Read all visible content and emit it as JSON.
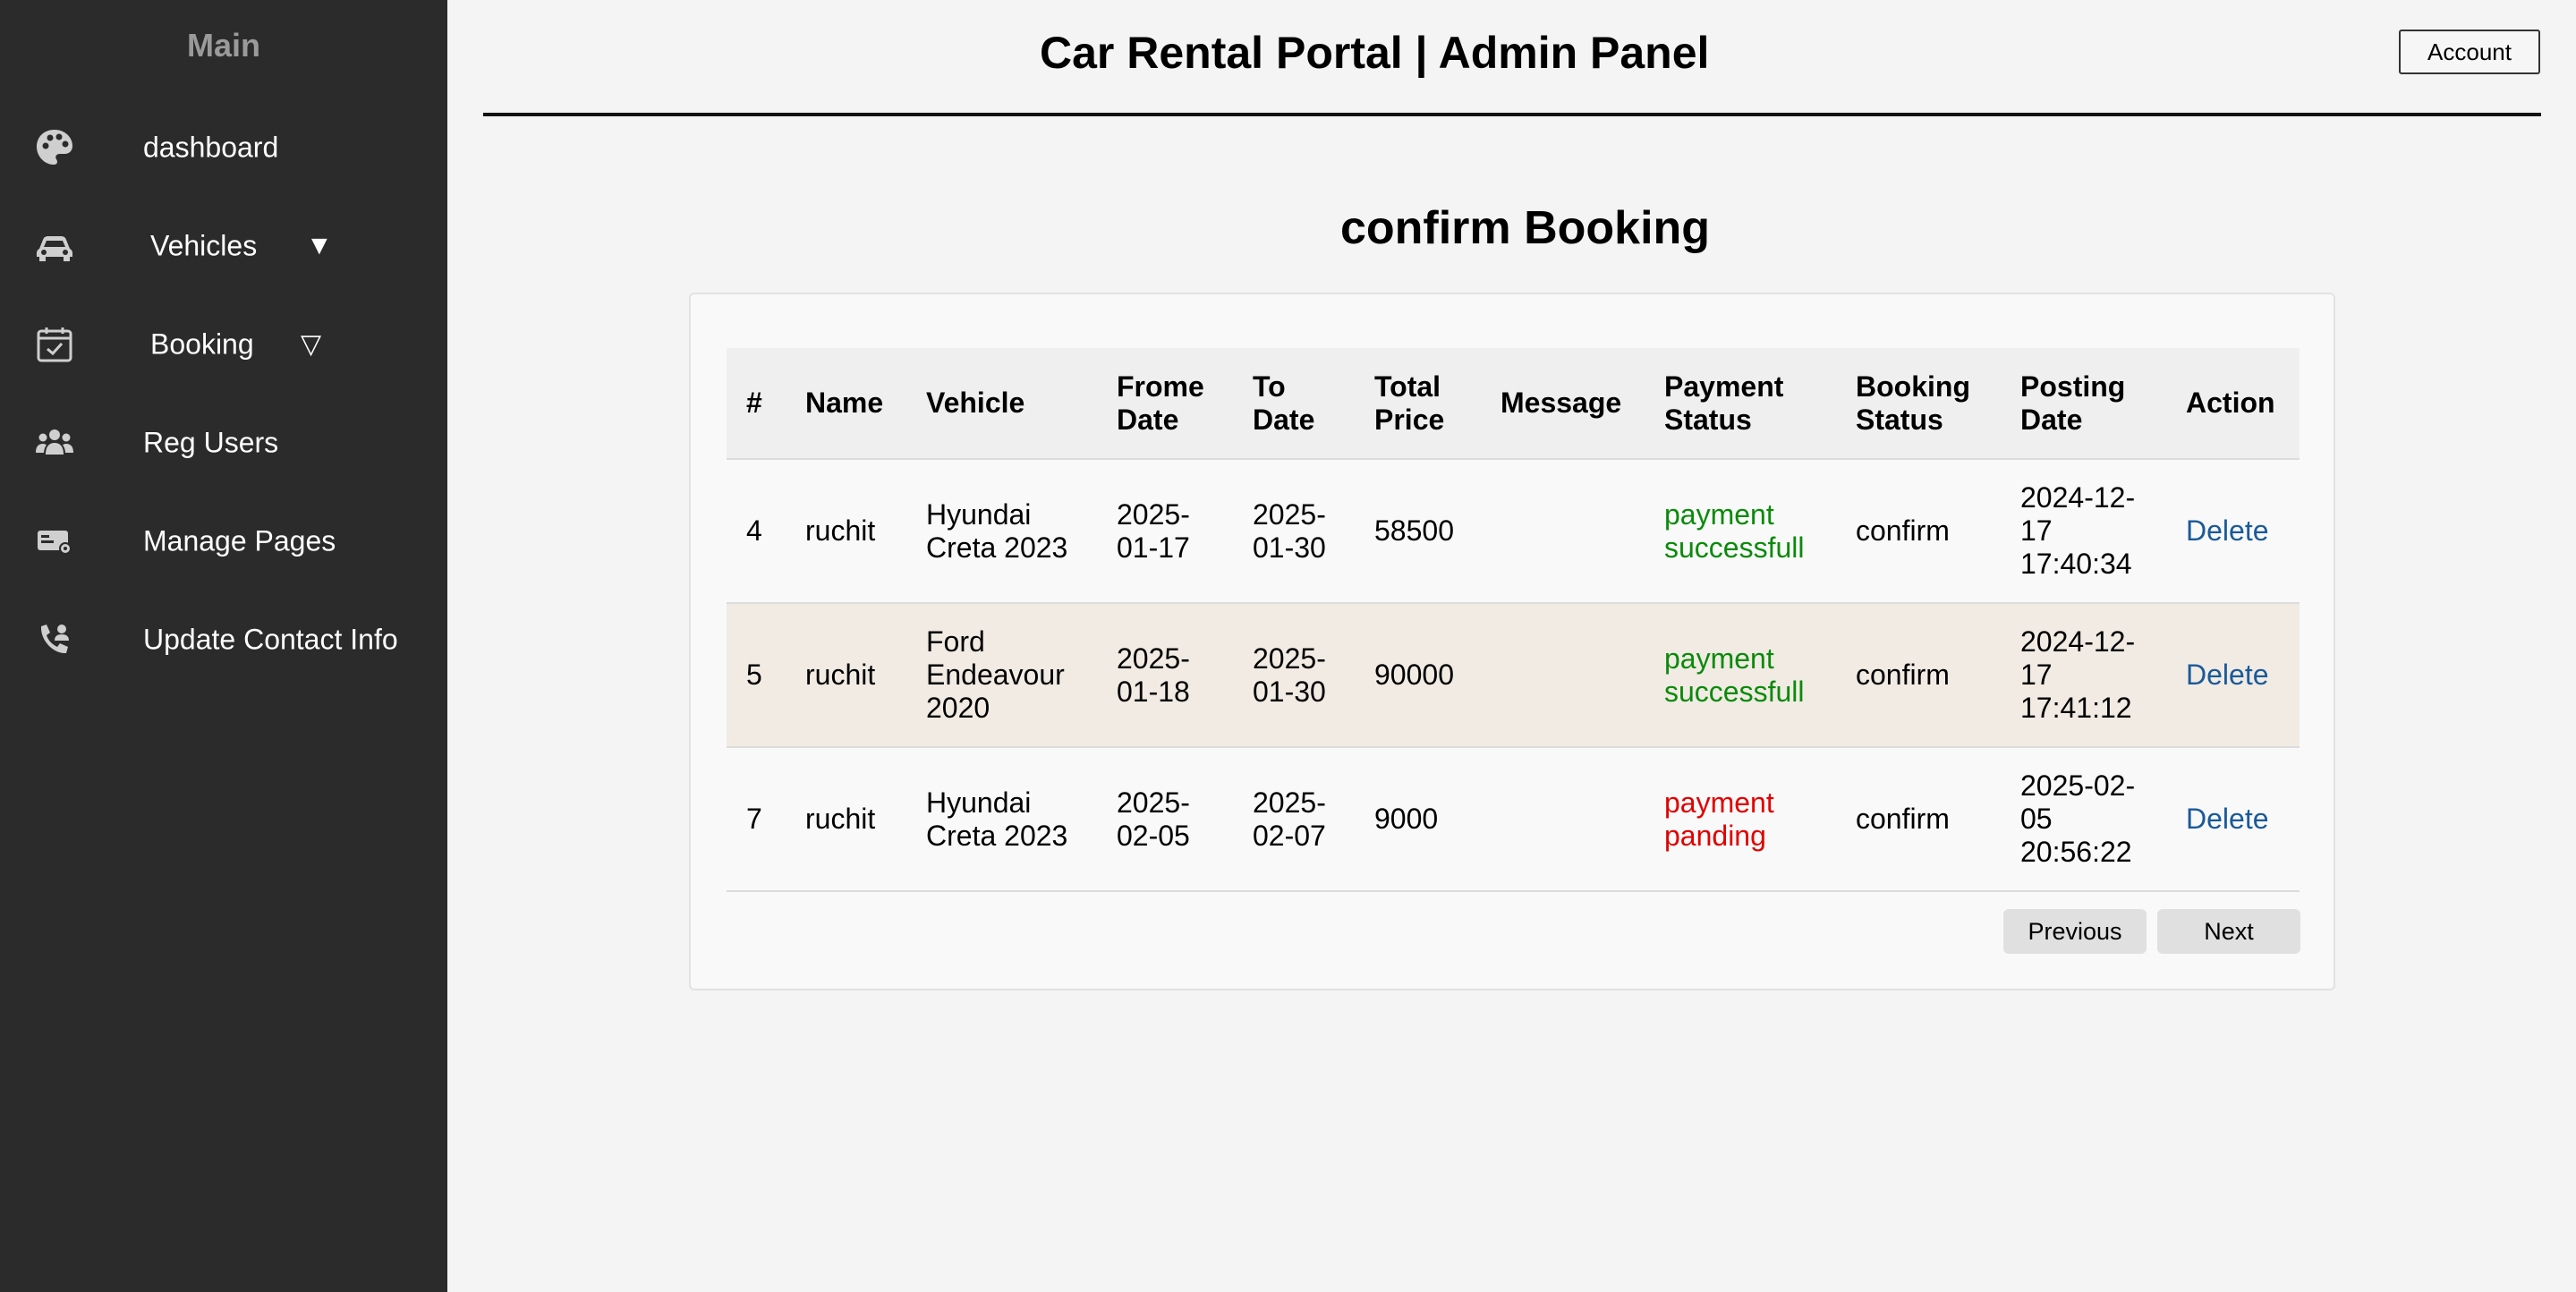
{
  "sidebar": {
    "title": "Main",
    "items": [
      {
        "label": "dashboard",
        "icon": "palette-icon"
      },
      {
        "label": "Vehicles",
        "icon": "car-icon",
        "caret": "▼"
      },
      {
        "label": "Booking",
        "icon": "calendar-check-icon",
        "caret": "▽"
      },
      {
        "label": "Reg Users",
        "icon": "users-icon"
      },
      {
        "label": "Manage Pages",
        "icon": "id-card-gear-icon"
      },
      {
        "label": "Update Contact Info",
        "icon": "phone-user-icon"
      }
    ]
  },
  "header": {
    "title": "Car Rental Portal | Admin Panel",
    "account_label": "Account"
  },
  "main": {
    "section_title": "confirm Booking",
    "table": {
      "headers": [
        "#",
        "Name",
        "Vehicle",
        "Frome Date",
        "To Date",
        "Total Price",
        "Message",
        "Payment Status",
        "Booking Status",
        "Posting Date",
        "Action"
      ],
      "rows": [
        {
          "id": "4",
          "name": "ruchit",
          "vehicle": "Hyundai Creta 2023",
          "from_date": "2025-01-17",
          "to_date": "2025-01-30",
          "total_price": "58500",
          "message": "",
          "payment_status": "payment successfull",
          "booking_status": "confirm",
          "posting_date": "2024-12-17 17:40:34",
          "action": "Delete"
        },
        {
          "id": "5",
          "name": "ruchit",
          "vehicle": "Ford Endeavour 2020",
          "from_date": "2025-01-18",
          "to_date": "2025-01-30",
          "total_price": "90000",
          "message": "",
          "payment_status": "payment successfull",
          "booking_status": "confirm",
          "posting_date": "2024-12-17 17:41:12",
          "action": "Delete"
        },
        {
          "id": "7",
          "name": "ruchit",
          "vehicle": "Hyundai Creta 2023",
          "from_date": "2025-02-05",
          "to_date": "2025-02-07",
          "total_price": "9000",
          "message": "",
          "payment_status": "payment panding",
          "booking_status": "confirm",
          "posting_date": "2025-02-05 20:56:22",
          "action": "Delete"
        }
      ]
    },
    "pagination": {
      "previous_label": "Previous",
      "next_label": "Next"
    }
  },
  "colors": {
    "sidebar_bg": "#2b2b2b",
    "payment_success": "#0a8a0a",
    "payment_pending": "#e00000",
    "link": "#1a5a99",
    "alt_row": "#f1ebe4"
  }
}
